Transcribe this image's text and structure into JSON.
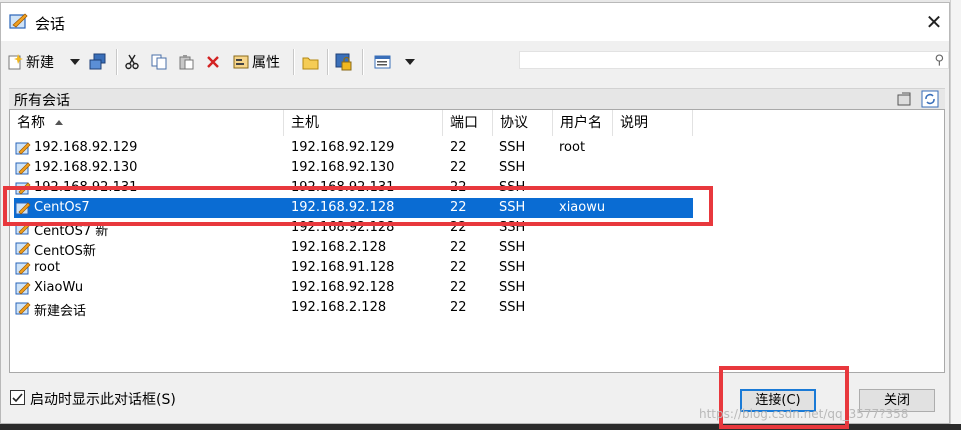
{
  "window": {
    "title": "会话"
  },
  "toolbar": {
    "new_label": "新建",
    "properties_label": "属性"
  },
  "search": {
    "placeholder": ""
  },
  "group": {
    "label": "所有会话"
  },
  "columns": [
    "名称",
    "主机",
    "端口",
    "协议",
    "用户名",
    "说明"
  ],
  "sessions": [
    {
      "name": "192.168.92.129",
      "host": "192.168.92.129",
      "port": "22",
      "protocol": "SSH",
      "user": "root",
      "note": ""
    },
    {
      "name": "192.168.92.130",
      "host": "192.168.92.130",
      "port": "22",
      "protocol": "SSH",
      "user": "",
      "note": ""
    },
    {
      "name": "192.168.92.131",
      "host": "192.168.92.131",
      "port": "22",
      "protocol": "SSH",
      "user": "",
      "note": ""
    },
    {
      "name": "CentOs7",
      "host": "192.168.92.128",
      "port": "22",
      "protocol": "SSH",
      "user": "xiaowu",
      "note": ""
    },
    {
      "name": "CentOS7 新",
      "host": "192.168.92.128",
      "port": "22",
      "protocol": "SSH",
      "user": "",
      "note": ""
    },
    {
      "name": "CentOS新",
      "host": "192.168.2.128",
      "port": "22",
      "protocol": "SSH",
      "user": "",
      "note": ""
    },
    {
      "name": "root",
      "host": "192.168.91.128",
      "port": "22",
      "protocol": "SSH",
      "user": "",
      "note": ""
    },
    {
      "name": "XiaoWu",
      "host": "192.168.92.128",
      "port": "22",
      "protocol": "SSH",
      "user": "",
      "note": ""
    },
    {
      "name": "新建会话",
      "host": "192.168.2.128",
      "port": "22",
      "protocol": "SSH",
      "user": "",
      "note": ""
    }
  ],
  "selected_session": "CentOs7",
  "footer": {
    "show_on_startup_label": "启动时显示此对话框(S)",
    "show_on_startup_checked": true,
    "connect_label": "连接(C)",
    "close_label": "关闭"
  },
  "watermark": "https://blog.csdn.net/qq_3577?358",
  "colors": {
    "selection": "#0a6cd3",
    "highlight_box": "#e8383d",
    "primary_border": "#1a7ad6"
  }
}
